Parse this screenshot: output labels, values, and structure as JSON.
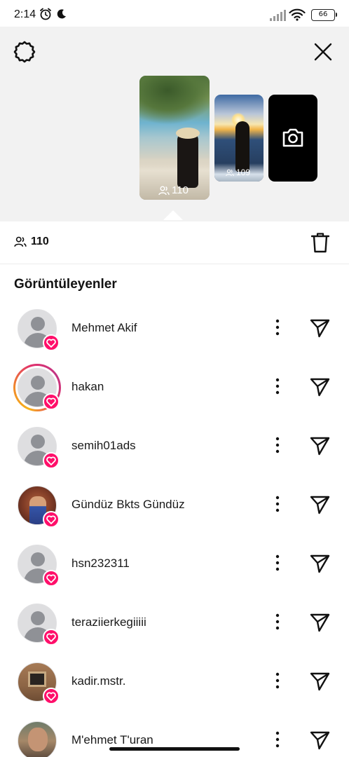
{
  "status_bar": {
    "time": "2:14",
    "battery": "66",
    "icons": [
      "alarm-icon",
      "moon-icon",
      "signal-icon",
      "wifi-icon",
      "battery-icon"
    ]
  },
  "header": {
    "settings_icon": "gear-icon",
    "close_icon": "close-icon"
  },
  "stories": [
    {
      "viewers": "110",
      "selected": true
    },
    {
      "viewers": "109",
      "selected": false
    }
  ],
  "summary": {
    "viewer_count": "110",
    "delete_icon": "trash-icon"
  },
  "viewers_section": {
    "title": "Görüntüleyenler",
    "viewers": [
      {
        "username": "Mehmet Akif",
        "liked": true,
        "avatar": "default"
      },
      {
        "username": "hakan",
        "liked": true,
        "avatar": "default",
        "story_ring": true
      },
      {
        "username": "semih01ads",
        "liked": true,
        "avatar": "default"
      },
      {
        "username": "Gündüz Bkts Gündüz",
        "liked": true,
        "avatar": "photo"
      },
      {
        "username": "hsn232311",
        "liked": true,
        "avatar": "default"
      },
      {
        "username": "teraziierkegiiiii",
        "liked": true,
        "avatar": "default"
      },
      {
        "username": "kadir.mstr.",
        "liked": true,
        "avatar": "photo"
      },
      {
        "username": "M'ehmet T'uran",
        "liked": false,
        "avatar": "photo"
      }
    ]
  },
  "colors": {
    "like_badge": "#ff0f6a",
    "story_background": "#f2f2f2"
  }
}
